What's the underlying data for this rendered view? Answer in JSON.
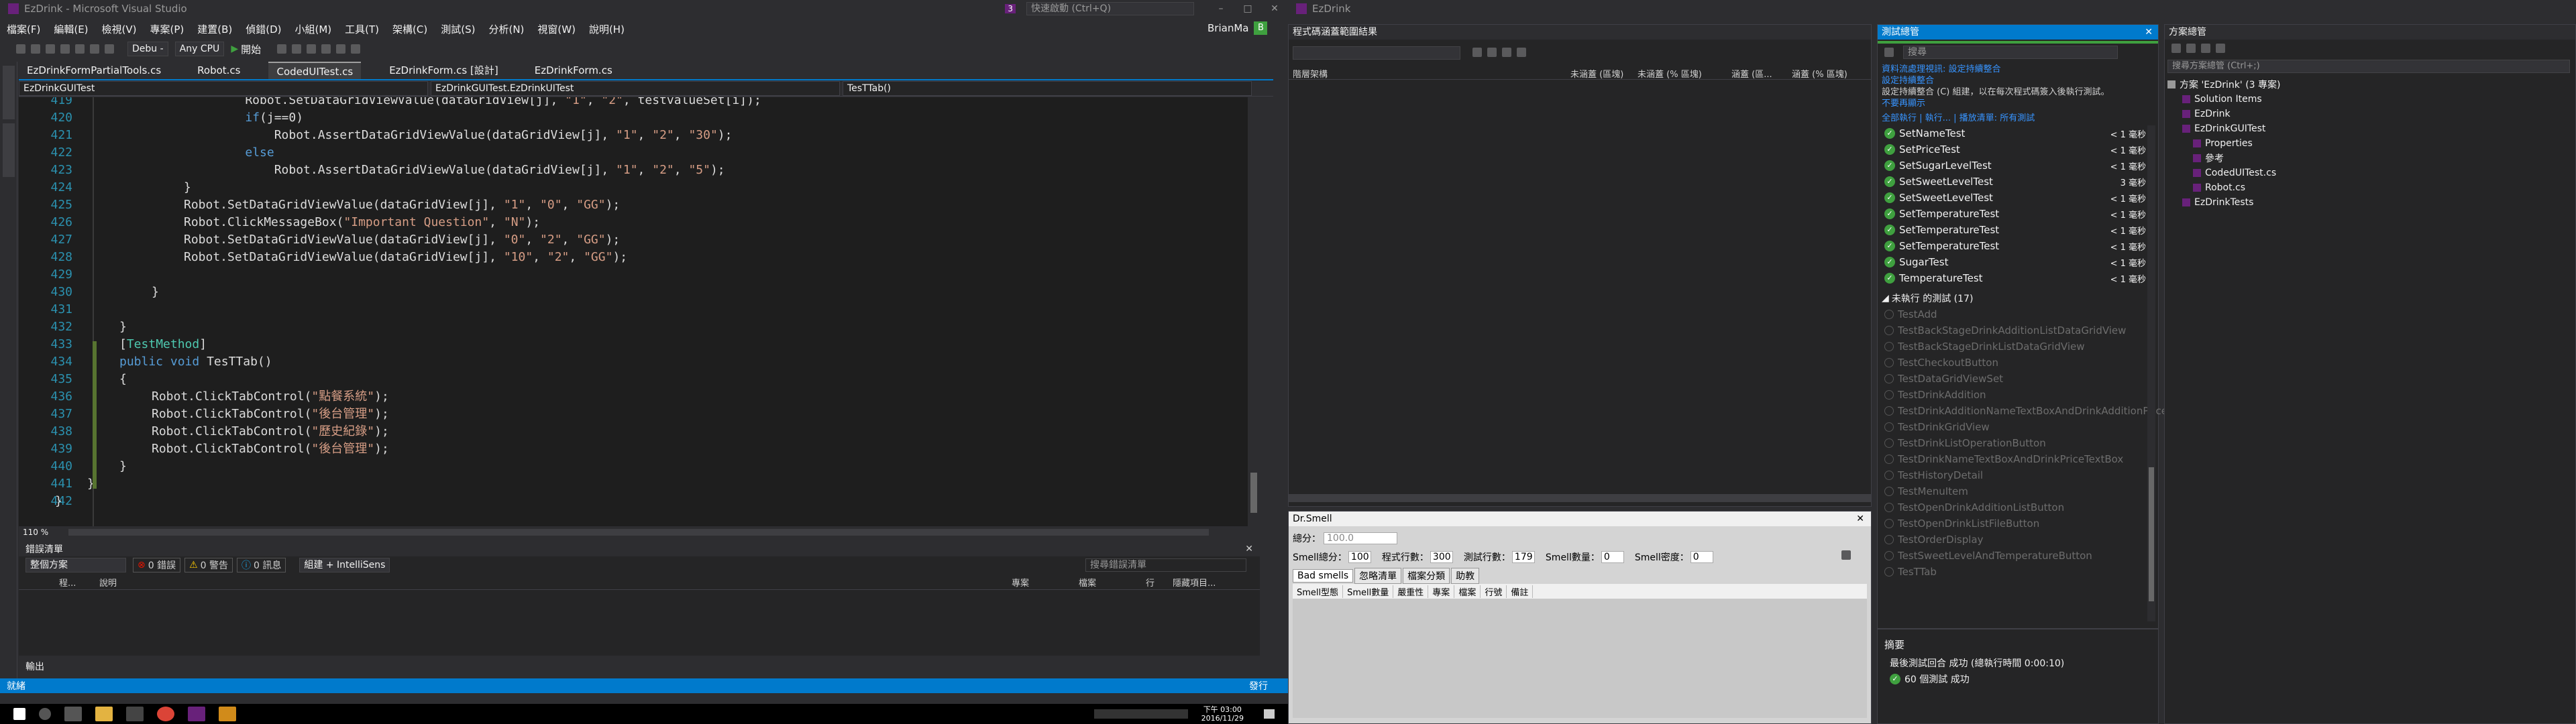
{
  "window": {
    "title": "EzDrink - Microsoft Visual Studio",
    "quick_launch": "快速啟動 (Ctrl+Q)",
    "user": "BrianMa",
    "notif_count": "3",
    "user_badge": "B"
  },
  "menu": [
    "檔案(F)",
    "編輯(E)",
    "檢視(V)",
    "專案(P)",
    "建置(B)",
    "偵錯(D)",
    "小組(M)",
    "工具(T)",
    "架構(C)",
    "測試(S)",
    "分析(N)",
    "視窗(W)",
    "說明(H)"
  ],
  "toolbar": {
    "config": "Debu -",
    "platform": "Any CPU",
    "start": "開始"
  },
  "doc_tabs": [
    "EzDrinkFormPartialTools.cs",
    "Robot.cs",
    "CodedUITest.cs",
    "EzDrinkForm.cs [設計]",
    "EzDrinkForm.cs"
  ],
  "nav": {
    "project": "EzDrinkGUITest",
    "class": "EzDrinkGUITest.EzDrinkUITest",
    "member": "TesTTab()"
  },
  "code": {
    "line_numbers": [
      "419",
      "420",
      "421",
      "422",
      "423",
      "424",
      "425",
      "426",
      "427",
      "428",
      "429",
      "430",
      "431",
      "432",
      "433",
      "434",
      "435",
      "436",
      "437",
      "438",
      "439",
      "440",
      "441",
      "442"
    ],
    "lines": [
      {
        "indent": "    ",
        "text": "Robot.SetDataGridViewValue(dataGridView[j], \"1\", \"2\", testvalueSet[i]);"
      },
      {
        "indent": "    ",
        "text": "if(j==0)"
      },
      {
        "indent": "        ",
        "text": "Robot.AssertDataGridViewValue(dataGridView[j], \"1\", \"2\", \"30\");"
      },
      {
        "indent": "    ",
        "text": "else"
      },
      {
        "indent": "        ",
        "text": "Robot.AssertDataGridViewValue(dataGridView[j], \"1\", \"2\", \"5\");"
      },
      {
        "indent": "",
        "text": "}"
      },
      {
        "indent": "",
        "text": "Robot.SetDataGridViewValue(dataGridView[j], \"1\", \"0\", \"GG\");"
      },
      {
        "indent": "",
        "text": "Robot.ClickMessageBox(\"Important Question\", \"N\");"
      },
      {
        "indent": "",
        "text": "Robot.SetDataGridViewValue(dataGridView[j], \"0\", \"2\", \"GG\");"
      },
      {
        "indent": "",
        "text": "Robot.SetDataGridViewValue(dataGridView[j], \"10\", \"2\", \"GG\");"
      },
      {
        "indent": "",
        "text": ""
      },
      {
        "indent": "",
        "text": "}"
      },
      {
        "indent": "",
        "text": ""
      },
      {
        "indent": "",
        "text": "}"
      },
      {
        "indent": "",
        "text": "[TestMethod]"
      },
      {
        "indent": "",
        "text": "public void TesTTab()"
      },
      {
        "indent": "",
        "text": "{"
      },
      {
        "indent": "",
        "text": "Robot.ClickTabControl(\"點餐系統\");"
      },
      {
        "indent": "",
        "text": "Robot.ClickTabControl(\"後台管理\");"
      },
      {
        "indent": "",
        "text": "Robot.ClickTabControl(\"歷史紀錄\");"
      },
      {
        "indent": "",
        "text": "Robot.ClickTabControl(\"後台管理\");"
      },
      {
        "indent": "",
        "text": "}"
      },
      {
        "indent": "",
        "text": "}"
      },
      {
        "indent": "",
        "text": "}"
      }
    ],
    "zoom": "110 %"
  },
  "error_list": {
    "title": "錯誤清單",
    "scope": "整個方案",
    "errors": "0 錯誤",
    "warnings": "0 警告",
    "messages": "0 訊息",
    "build": "組建 + IntelliSens",
    "search": "搜尋錯誤清單",
    "cols": [
      "程...",
      "說明",
      "專案",
      "檔案",
      "行",
      "隱藏項目..."
    ]
  },
  "output_tab": "輸出",
  "status": {
    "left": "就緒",
    "right": "發行"
  },
  "coverage": {
    "title": "EzDrink",
    "panel_title": "程式碼涵蓋範圍結果",
    "cols": [
      "階層架構",
      "未涵蓋 (區塊)",
      "未涵蓋 (% 區塊)",
      "涵蓋 (區...",
      "涵蓋 (% 區塊)"
    ]
  },
  "drsmell": {
    "title": "Dr.Smell",
    "score_label": "總分：",
    "score_value": "100.0",
    "fields": [
      {
        "label": "Smell總分：",
        "value": "100"
      },
      {
        "label": "程式行數：",
        "value": "300"
      },
      {
        "label": "測試行數：",
        "value": "179"
      },
      {
        "label": "Smell數量：",
        "value": "0"
      },
      {
        "label": "Smell密度：",
        "value": "0"
      }
    ],
    "tabs": [
      "Bad smells",
      "忽略清單",
      "檔案分類",
      "助教"
    ],
    "cols": [
      "Smell型態",
      "Smell數量",
      "嚴重性",
      "專案",
      "檔案",
      "行號",
      "備註"
    ]
  },
  "test_explorer": {
    "title": "測試總管",
    "search": "搜尋",
    "warning": "資料流處理視訊: 設定持續整合",
    "warning2": "設定持續整合",
    "warning3": "設定持續整合 (C) 組建，以在每次程式碼簽入後執行測試。",
    "dont_show": "不要再顯示",
    "links": "全部執行 | 執行... | 播放清單: 所有測試",
    "passed": [
      {
        "name": "SetNameTest",
        "time": "< 1 毫秒"
      },
      {
        "name": "SetPriceTest",
        "time": "< 1 毫秒"
      },
      {
        "name": "SetSugarLevelTest",
        "time": "< 1 毫秒"
      },
      {
        "name": "SetSweetLevelTest",
        "time": "3 毫秒"
      },
      {
        "name": "SetSweetLevelTest",
        "time": "< 1 毫秒"
      },
      {
        "name": "SetTemperatureTest",
        "time": "< 1 毫秒"
      },
      {
        "name": "SetTemperatureTest",
        "time": "< 1 毫秒"
      },
      {
        "name": "SetTemperatureTest",
        "time": "< 1 毫秒"
      },
      {
        "name": "SugarTest",
        "time": "< 1 毫秒"
      },
      {
        "name": "TemperatureTest",
        "time": "< 1 毫秒"
      }
    ],
    "not_run_header": "未執行 的測試 (17)",
    "not_run": [
      "TestAdd",
      "TestBackStageDrinkAdditionListDataGridView",
      "TestBackStageDrinkListDataGridView",
      "TestCheckoutButton",
      "TestDataGridViewSet",
      "TestDrinkAddition",
      "TestDrinkAdditionNameTextBoxAndDrinkAdditionPriceTextBox",
      "TestDrinkGridView",
      "TestDrinkListOperationButton",
      "TestDrinkNameTextBoxAndDrinkPriceTextBox",
      "TestHistoryDetail",
      "TestMenuItem",
      "TestOpenDrinkAdditionListButton",
      "TestOpenDrinkListFileButton",
      "TestOrderDisplay",
      "TestSweetLevelAndTemperatureButton",
      "TesTTab"
    ],
    "summary_title": "摘要",
    "summary_line1": "最後測試回合 成功 (總執行時間 0:00:10)",
    "summary_line2": "60 個測試 成功"
  },
  "solution": {
    "title": "方案總管",
    "search": "搜尋方案總管 (Ctrl+;)",
    "items": [
      {
        "label": "方案 'EzDrink' (3 專案)",
        "depth": 0
      },
      {
        "label": "Solution Items",
        "depth": 1
      },
      {
        "label": "EzDrink",
        "depth": 1
      },
      {
        "label": "EzDrinkGUITest",
        "depth": 1
      },
      {
        "label": "Properties",
        "depth": 2
      },
      {
        "label": "參考",
        "depth": 2
      },
      {
        "label": "CodedUITest.cs",
        "depth": 2
      },
      {
        "label": "Robot.cs",
        "depth": 2
      },
      {
        "label": "EzDrinkTests",
        "depth": 1
      }
    ]
  },
  "taskbar": {
    "time": "下午 03:00",
    "date": "2016/11/29"
  },
  "colors": {
    "accent": "#007acc",
    "pass": "#3fa03f",
    "error": "#e51400",
    "warning": "#ffcc00",
    "info": "#1ba1e2"
  }
}
